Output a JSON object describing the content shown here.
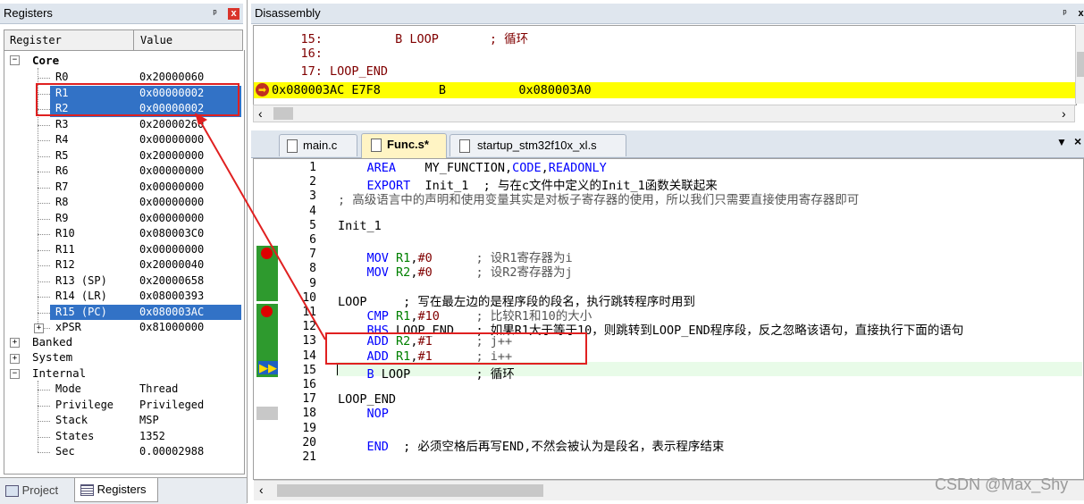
{
  "registers_panel": {
    "title": "Registers",
    "pin_glyph": "ᵖ",
    "close_glyph": "x",
    "columns": [
      "Register",
      "Value"
    ],
    "groups": {
      "core": "Core",
      "banked": "Banked",
      "system": "System",
      "internal": "Internal"
    },
    "core_rows": [
      {
        "name": "R0",
        "value": "0x20000060",
        "selected": false
      },
      {
        "name": "R1",
        "value": "0x00000002",
        "selected": true
      },
      {
        "name": "R2",
        "value": "0x00000002",
        "selected": true
      },
      {
        "name": "R3",
        "value": "0x20000260",
        "selected": false
      },
      {
        "name": "R4",
        "value": "0x00000000",
        "selected": false
      },
      {
        "name": "R5",
        "value": "0x20000000",
        "selected": false
      },
      {
        "name": "R6",
        "value": "0x00000000",
        "selected": false
      },
      {
        "name": "R7",
        "value": "0x00000000",
        "selected": false
      },
      {
        "name": "R8",
        "value": "0x00000000",
        "selected": false
      },
      {
        "name": "R9",
        "value": "0x00000000",
        "selected": false
      },
      {
        "name": "R10",
        "value": "0x080003C0",
        "selected": false
      },
      {
        "name": "R11",
        "value": "0x00000000",
        "selected": false
      },
      {
        "name": "R12",
        "value": "0x20000040",
        "selected": false
      },
      {
        "name": "R13 (SP)",
        "value": "0x20000658",
        "selected": false
      },
      {
        "name": "R14 (LR)",
        "value": "0x08000393",
        "selected": false
      },
      {
        "name": "R15 (PC)",
        "value": "0x080003AC",
        "selected": true
      },
      {
        "name": "xPSR",
        "value": "0x81000000",
        "selected": false
      }
    ],
    "internal_rows": [
      {
        "name": "Mode",
        "value": "Thread"
      },
      {
        "name": "Privilege",
        "value": "Privileged"
      },
      {
        "name": "Stack",
        "value": "MSP"
      },
      {
        "name": "States",
        "value": "1352"
      },
      {
        "name": "Sec",
        "value": "0.00002988"
      }
    ],
    "bottom_tabs": [
      "Project",
      "Registers"
    ]
  },
  "disassembly": {
    "title": "Disassembly",
    "lines": [
      {
        "text": "    15:          B LOOP       ; 循环"
      },
      {
        "text": "    16:"
      },
      {
        "text": "    17: LOOP_END"
      },
      {
        "text": "0x080003AC E7F8        B          0x080003A0"
      }
    ]
  },
  "editor": {
    "tabs": [
      {
        "label": "main.c",
        "active": false
      },
      {
        "label": "Func.s*",
        "active": true
      },
      {
        "label": "startup_stm32f10x_xl.s",
        "active": false
      }
    ],
    "lines": [
      {
        "n": "1",
        "parts": [
          [
            "    ",
            ""
          ],
          [
            "AREA",
            "kw"
          ],
          [
            "    MY_FUNCTION,",
            ""
          ],
          [
            "CODE",
            "kw"
          ],
          [
            ",",
            ""
          ],
          [
            "READONLY",
            "kw"
          ]
        ]
      },
      {
        "n": "2",
        "parts": [
          [
            "    ",
            ""
          ],
          [
            "EXPORT",
            "kw"
          ],
          [
            "  Init_1  ; 与在c文件中定义的Init_1函数关联起来",
            ""
          ]
        ]
      },
      {
        "n": "3",
        "parts": [
          [
            "; 高级语言中的声明和使用变量其实是对板子寄存器的使用，所以我们只需要直接使用寄存器即可",
            "cm"
          ]
        ]
      },
      {
        "n": "4",
        "parts": []
      },
      {
        "n": "5",
        "parts": [
          [
            "Init_1",
            ""
          ]
        ]
      },
      {
        "n": "6",
        "parts": []
      },
      {
        "n": "7",
        "parts": [
          [
            "    ",
            ""
          ],
          [
            "MOV",
            "kw"
          ],
          [
            " ",
            ""
          ],
          [
            "R1",
            "rg"
          ],
          [
            ",",
            ""
          ],
          [
            "#0",
            "num"
          ],
          [
            "      ; 设R1寄存器为i",
            "cm"
          ]
        ]
      },
      {
        "n": "8",
        "parts": [
          [
            "    ",
            ""
          ],
          [
            "MOV",
            "kw"
          ],
          [
            " ",
            ""
          ],
          [
            "R2",
            "rg"
          ],
          [
            ",",
            ""
          ],
          [
            "#0",
            "num"
          ],
          [
            "      ; 设R2寄存器为j",
            "cm"
          ]
        ]
      },
      {
        "n": "9",
        "parts": []
      },
      {
        "n": "10",
        "parts": [
          [
            "LOOP     ; 写在最左边的是程序段的段名，执行跳转程序时用到",
            ""
          ]
        ]
      },
      {
        "n": "11",
        "parts": [
          [
            "    ",
            ""
          ],
          [
            "CMP",
            "kw"
          ],
          [
            " ",
            ""
          ],
          [
            "R1",
            "rg"
          ],
          [
            ",",
            ""
          ],
          [
            "#10",
            "num"
          ],
          [
            "     ; 比较R1和10的大小",
            "cm"
          ]
        ]
      },
      {
        "n": "12",
        "parts": [
          [
            "    ",
            ""
          ],
          [
            "BHS",
            "kw"
          ],
          [
            " LOOP_END   ; 如果R1大于等于10，则跳转到LOOP_END程序段，反之忽略该语句，直接执行下面的语句",
            ""
          ]
        ]
      },
      {
        "n": "13",
        "parts": [
          [
            "    ",
            ""
          ],
          [
            "ADD",
            "kw"
          ],
          [
            " ",
            ""
          ],
          [
            "R2",
            "rg"
          ],
          [
            ",",
            ""
          ],
          [
            "#1",
            "num"
          ],
          [
            "      ; j++",
            "cm"
          ]
        ]
      },
      {
        "n": "14",
        "parts": [
          [
            "    ",
            ""
          ],
          [
            "ADD",
            "kw"
          ],
          [
            " ",
            ""
          ],
          [
            "R1",
            "rg"
          ],
          [
            ",",
            ""
          ],
          [
            "#1",
            "num"
          ],
          [
            "      ; i++",
            "cm"
          ]
        ]
      },
      {
        "n": "15",
        "parts": [
          [
            "    ",
            ""
          ],
          [
            "B",
            "kw"
          ],
          [
            " LOOP         ; 循环",
            ""
          ]
        ]
      },
      {
        "n": "16",
        "parts": []
      },
      {
        "n": "17",
        "parts": [
          [
            "LOOP_END",
            ""
          ]
        ]
      },
      {
        "n": "18",
        "parts": [
          [
            "    ",
            ""
          ],
          [
            "NOP",
            "kw"
          ]
        ]
      },
      {
        "n": "19",
        "parts": []
      },
      {
        "n": "20",
        "parts": [
          [
            "    ",
            ""
          ],
          [
            "END",
            "kw"
          ],
          [
            "  ; 必须空格后再写END,不然会被认为是段名，表示程序结束",
            ""
          ]
        ]
      },
      {
        "n": "21",
        "parts": []
      }
    ]
  },
  "watermark": "CSDN @Max_Shy",
  "colors": {
    "selection": "#3272c6",
    "current_line": "#ffff00",
    "breakpoint": "#dd0000",
    "annotation": "#e02020",
    "gutter": "#2e9a2e"
  }
}
